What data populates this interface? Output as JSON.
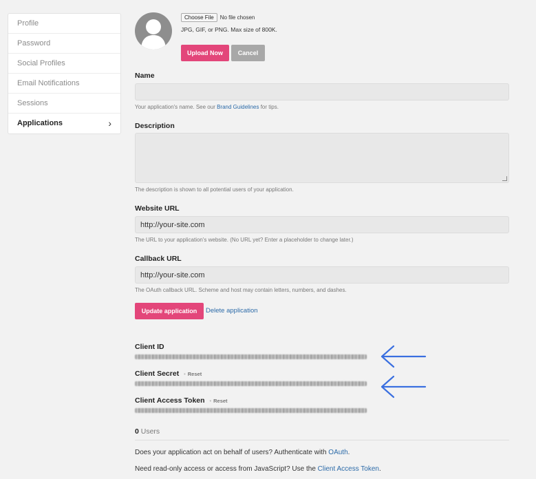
{
  "sidebar": {
    "items": [
      {
        "label": "Profile"
      },
      {
        "label": "Password"
      },
      {
        "label": "Social Profiles"
      },
      {
        "label": "Email Notifications"
      },
      {
        "label": "Sessions"
      },
      {
        "label": "Applications"
      }
    ],
    "active_chevron": "›"
  },
  "upload": {
    "choose_label": "Choose File",
    "file_status": "No file chosen",
    "hint": "JPG, GIF, or PNG. Max size of 800K.",
    "upload_label": "Upload Now",
    "cancel_label": "Cancel"
  },
  "form": {
    "name_label": "Name",
    "name_value": "",
    "name_hint_prefix": "Your application's name. See our ",
    "name_hint_link": "Brand Guidelines",
    "name_hint_suffix": " for tips.",
    "description_label": "Description",
    "description_value": "",
    "description_hint": "The description is shown to all potential users of your application.",
    "website_label": "Website URL",
    "website_value": "http://your-site.com",
    "website_hint": "The URL to your application's website. (No URL yet? Enter a placeholder to change later.)",
    "callback_label": "Callback URL",
    "callback_value": "http://your-site.com",
    "callback_hint": "The OAuth callback URL. Scheme and host may contain letters, numbers, and dashes.",
    "update_label": "Update application",
    "delete_label": "Delete application"
  },
  "credentials": {
    "client_id_label": "Client ID",
    "client_secret_label": "Client Secret",
    "client_token_label": "Client Access Token",
    "reset_label": "Reset",
    "dot": "•"
  },
  "users": {
    "count": "0",
    "label": " Users"
  },
  "footer": {
    "line1_prefix": "Does your application act on behalf of users? Authenticate with ",
    "line1_link": "OAuth",
    "line1_suffix": ".",
    "line2_prefix": "Need read-only access or access from JavaScript? Use the ",
    "line2_link": "Client Access Token",
    "line2_suffix": "."
  },
  "colors": {
    "primary_pink": "#e3467a",
    "link_blue": "#2b6aa8",
    "arrow_blue": "#3a6fe0"
  }
}
